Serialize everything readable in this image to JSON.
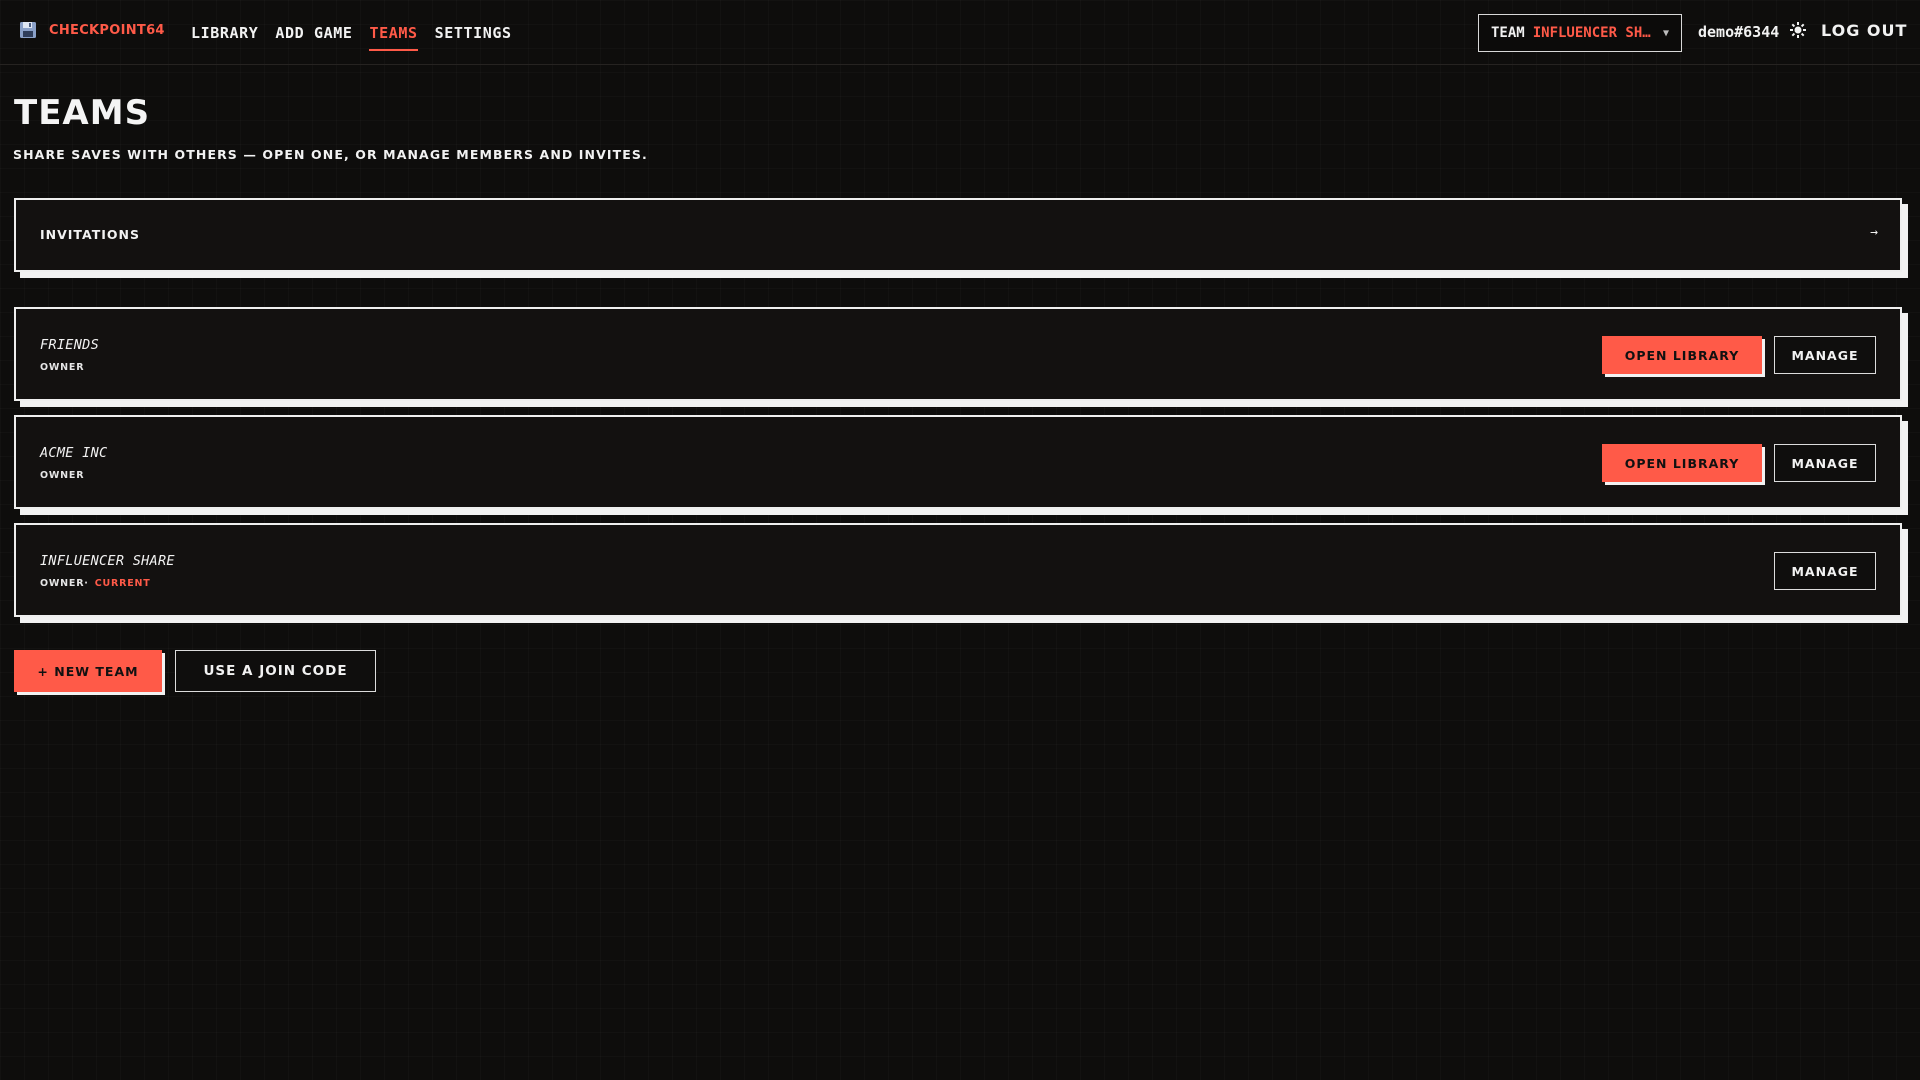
{
  "app": {
    "brand_name": "CHECKPOINT64",
    "brand_icon": "floppy-disk-icon",
    "accent_color": "#ff5a48"
  },
  "nav": {
    "items": [
      {
        "label": "LIBRARY",
        "active": false
      },
      {
        "label": "ADD GAME",
        "active": false
      },
      {
        "label": "TEAMS",
        "active": true
      },
      {
        "label": "SETTINGS",
        "active": false
      }
    ]
  },
  "header": {
    "team_select_prefix": "TEAM",
    "team_select_value": "INFLUENCER SH…",
    "user_name": "demo#6344",
    "theme_icon": "sun-icon",
    "logout_label": "LOG OUT"
  },
  "page": {
    "title": "TEAMS",
    "subtitle": "SHARE SAVES WITH OTHERS — OPEN ONE, OR MANAGE MEMBERS AND INVITES."
  },
  "invitations": {
    "label": "INVITATIONS",
    "arrow": "→"
  },
  "teams": [
    {
      "name": "FRIENDS",
      "role": "OWNER",
      "current": "",
      "open_label": "OPEN LIBRARY",
      "manage_label": "MANAGE"
    },
    {
      "name": "ACME INC",
      "role": "OWNER",
      "current": "",
      "open_label": "OPEN LIBRARY",
      "manage_label": "MANAGE"
    },
    {
      "name": "INFLUENCER SHARE",
      "role": "OWNER·",
      "current": "CURRENT",
      "open_label": "",
      "manage_label": "MANAGE"
    }
  ],
  "actions": {
    "new_team_label": "+ NEW TEAM",
    "join_code_label": "USE A JOIN CODE"
  }
}
